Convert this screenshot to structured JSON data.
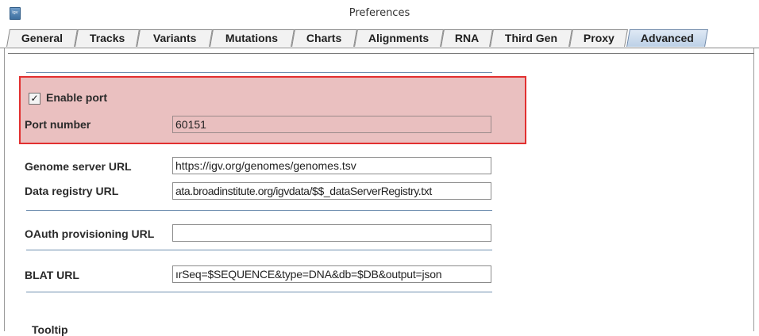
{
  "window": {
    "title": "Preferences",
    "icon": "igv-app-icon"
  },
  "tabs": [
    {
      "label": "General"
    },
    {
      "label": "Tracks"
    },
    {
      "label": "Variants"
    },
    {
      "label": "Mutations"
    },
    {
      "label": "Charts"
    },
    {
      "label": "Alignments"
    },
    {
      "label": "RNA"
    },
    {
      "label": "Third Gen"
    },
    {
      "label": "Proxy"
    },
    {
      "label": "Advanced"
    }
  ],
  "active_tab": "Advanced",
  "port": {
    "enable_label": "Enable port",
    "enable_checked": true,
    "checkmark": "✓",
    "port_number_label": "Port number",
    "port_number_value": "60151"
  },
  "urls": {
    "genome_label": "Genome server URL",
    "genome_value": "https://igv.org/genomes/genomes.tsv",
    "registry_label": "Data registry URL",
    "registry_value": "ata.broadinstitute.org/igvdata/$$_dataServerRegistry.txt",
    "oauth_label": "OAuth provisioning URL",
    "oauth_value": "",
    "blat_label": "BLAT URL",
    "blat_value": "ırSeq=$SEQUENCE&type=DNA&db=$DB&output=json"
  },
  "next_section_label": "Tooltip",
  "colors": {
    "highlight_border": "#e23030",
    "active_tab": "#bcd0e6"
  }
}
